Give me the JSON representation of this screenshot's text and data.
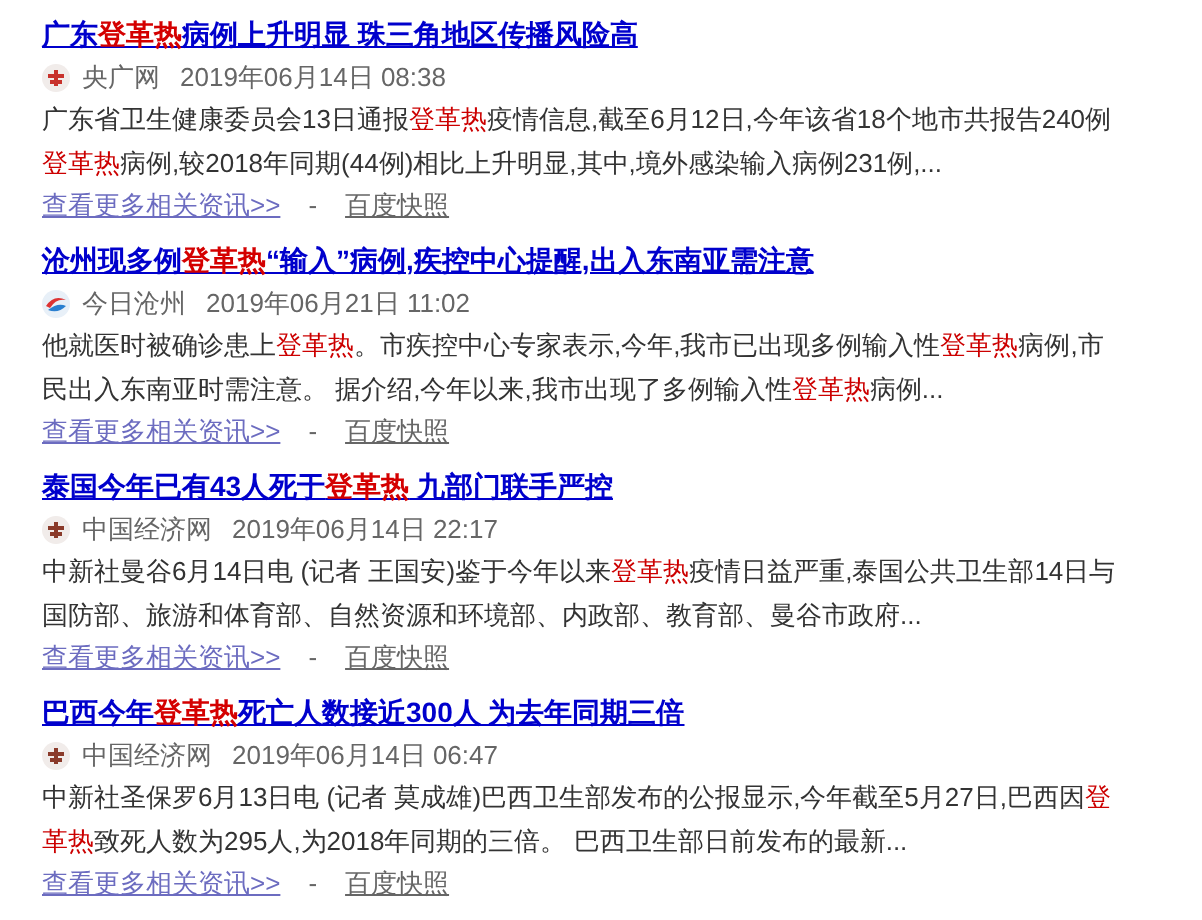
{
  "results": [
    {
      "title": [
        {
          "text": "广东",
          "highlight": false
        },
        {
          "text": "登革热",
          "highlight": true
        },
        {
          "text": "病例上升明显 珠三角地区传播风险高",
          "highlight": false
        }
      ],
      "source": "央广网",
      "date": "2019年06月14日 08:38",
      "logo": {
        "kind": "seal",
        "color": "#c8322c"
      },
      "snippet": [
        {
          "text": "广东省卫生健康委员会13日通报",
          "highlight": false
        },
        {
          "text": "登革热",
          "highlight": true
        },
        {
          "text": "疫情信息,截至6月12日,今年该省18个地市共报告240例",
          "highlight": false
        },
        {
          "text": "登革热",
          "highlight": true
        },
        {
          "text": "病例,较2018年同期(44例)相比上升明显,其中,境外感染输入病例231例,...",
          "highlight": false
        }
      ],
      "more_link": "查看更多相关资讯>>",
      "separator": "-",
      "cache_link": "百度快照"
    },
    {
      "title": [
        {
          "text": "沧州现多例",
          "highlight": false
        },
        {
          "text": "登革热",
          "highlight": true
        },
        {
          "text": "“输入”病例,疾控中心提醒,出入东南亚需注意",
          "highlight": false
        }
      ],
      "source": "今日沧州",
      "date": "2019年06月21日 11:02",
      "logo": {
        "kind": "swirl"
      },
      "snippet": [
        {
          "text": "他就医时被确诊患上",
          "highlight": false
        },
        {
          "text": "登革热",
          "highlight": true
        },
        {
          "text": "。市疾控中心专家表示,今年,我市已出现多例输入性",
          "highlight": false
        },
        {
          "text": "登革热",
          "highlight": true
        },
        {
          "text": "病例,市民出入东南亚时需注意。 据介绍,今年以来,我市出现了多例输入性",
          "highlight": false
        },
        {
          "text": "登革热",
          "highlight": true
        },
        {
          "text": "病例...",
          "highlight": false
        }
      ],
      "more_link": "查看更多相关资讯>>",
      "separator": "-",
      "cache_link": "百度快照"
    },
    {
      "title": [
        {
          "text": "泰国今年已有43人死于",
          "highlight": false
        },
        {
          "text": "登革热",
          "highlight": true
        },
        {
          "text": " 九部门联手严控",
          "highlight": false
        }
      ],
      "source": "中国经济网",
      "date": "2019年06月14日 22:17",
      "logo": {
        "kind": "seal",
        "color": "#8a3a2a"
      },
      "snippet": [
        {
          "text": "中新社曼谷6月14日电 (记者 王国安)鉴于今年以来",
          "highlight": false
        },
        {
          "text": "登革热",
          "highlight": true
        },
        {
          "text": "疫情日益严重,泰国公共卫生部14日与国防部、旅游和体育部、自然资源和环境部、内政部、教育部、曼谷市政府...",
          "highlight": false
        }
      ],
      "more_link": "查看更多相关资讯>>",
      "separator": "-",
      "cache_link": "百度快照"
    },
    {
      "title": [
        {
          "text": "巴西今年",
          "highlight": false
        },
        {
          "text": "登革热",
          "highlight": true
        },
        {
          "text": "死亡人数接近300人 为去年同期三倍",
          "highlight": false
        }
      ],
      "source": "中国经济网",
      "date": "2019年06月14日 06:47",
      "logo": {
        "kind": "seal",
        "color": "#8a3a2a"
      },
      "snippet": [
        {
          "text": "中新社圣保罗6月13日电 (记者 莫成雄)巴西卫生部发布的公报显示,今年截至5月27日,巴西因",
          "highlight": false
        },
        {
          "text": "登革热",
          "highlight": true
        },
        {
          "text": "致死人数为295人,为2018年同期的三倍。 巴西卫生部日前发布的最新...",
          "highlight": false
        }
      ],
      "more_link": "查看更多相关资讯>>",
      "separator": "-",
      "cache_link": "百度快照"
    }
  ]
}
